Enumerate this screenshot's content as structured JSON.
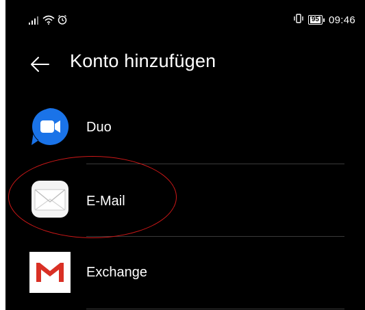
{
  "status_bar": {
    "battery_level": "95",
    "time": "09:46",
    "icons": [
      "signal-icon",
      "wifi-icon",
      "alarm-icon",
      "vibrate-icon",
      "battery-icon"
    ]
  },
  "header": {
    "title": "Konto hinzufügen",
    "back_icon": "arrow-left-icon"
  },
  "accounts": [
    {
      "label": "Duo",
      "icon": "duo-icon"
    },
    {
      "label": "E-Mail",
      "icon": "email-envelope-icon"
    },
    {
      "label": "Exchange",
      "icon": "gmail-icon"
    }
  ],
  "colors": {
    "background": "#000000",
    "text": "#ffffff",
    "divider": "#3a3a3a",
    "duo_blue": "#1a73e8",
    "gmail_red": "#d93025",
    "annotation_red": "#d01818"
  }
}
